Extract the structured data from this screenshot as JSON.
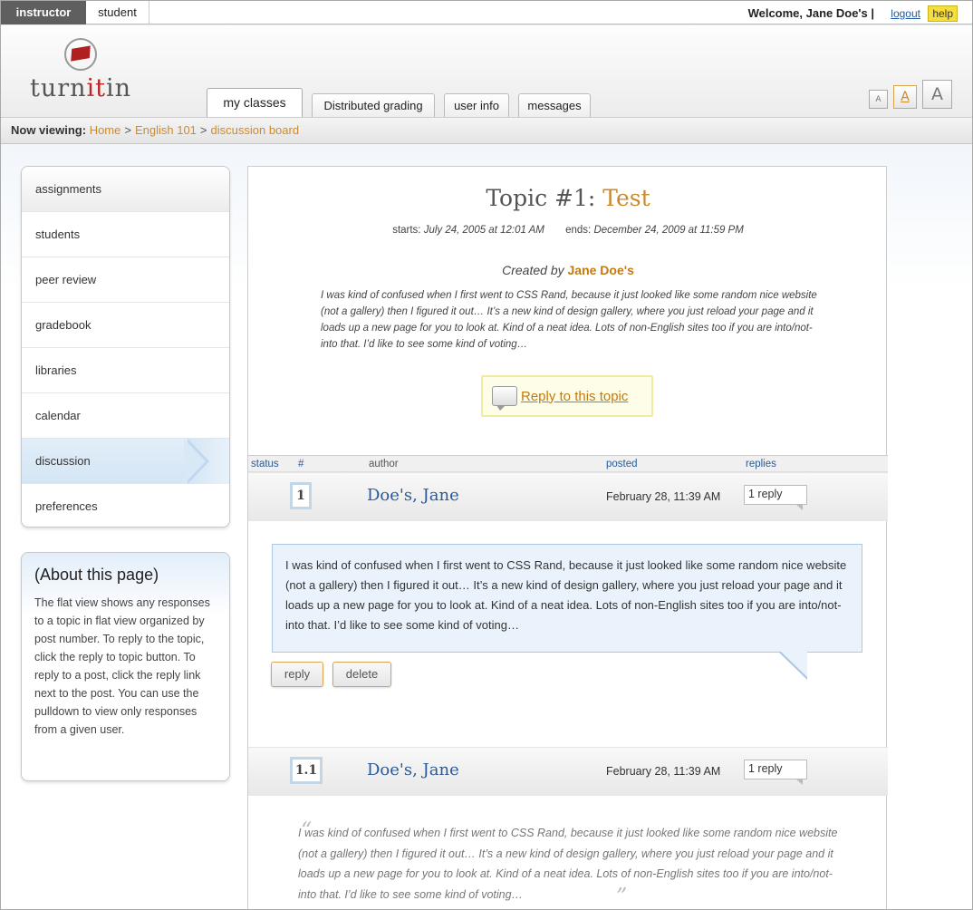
{
  "roles": {
    "instructor": "instructor",
    "student": "student"
  },
  "user": {
    "welcome": "Welcome, Jane Doe's |",
    "logout": "logout",
    "help": "help"
  },
  "logo": {
    "pre": "turn",
    "mid": "it",
    "post": "in"
  },
  "tabs": [
    "my classes",
    "Distributed grading",
    "user info",
    "messages"
  ],
  "font_sizes": [
    "A",
    "A",
    "A"
  ],
  "breadcrumb": {
    "label": "Now viewing:",
    "items": [
      "Home",
      "English 101",
      "discussion board"
    ],
    "separator": ">"
  },
  "sidebar": {
    "items": [
      "assignments",
      "students",
      "peer review",
      "gradebook",
      "libraries",
      "calendar",
      "discussion",
      "preferences"
    ],
    "active": "discussion"
  },
  "about": {
    "title": "(About this page)",
    "text": "The flat view shows any responses to a topic in flat view organized by post number. To reply to the topic, click the reply to topic button. To reply to a post, click the reply link next to the post. You can use the pulldown to view only responses from a given user."
  },
  "topic": {
    "prefix": "Topic #1:",
    "name": "Test",
    "starts_label": "starts:",
    "starts": "July 24, 2005 at 12:01 AM",
    "ends_label": "ends:",
    "ends": "December 24, 2009 at 11:59 PM",
    "created_label": "Created by",
    "created_by": "Jane Doe's",
    "excerpt": "I was kind of confused when I first went to CSS Rand, because it just looked like some random nice website (not a gallery) then I figured it out… It’s a new kind of design gallery, where you just reload your page and it loads up a new page for you to look at. Kind of a neat idea. Lots of non-English sites too if you are into/not-into that. I’d like to see some kind of voting…",
    "reply_button": "Reply to this topic"
  },
  "columns": {
    "status": "status",
    "num": "#",
    "author": "author",
    "posted": "posted",
    "replies": "replies"
  },
  "posts": [
    {
      "num": "1",
      "author": "Doe's, Jane",
      "posted": "February 28, 11:39 AM",
      "replies": "1 reply",
      "body": "I was kind of confused when I first went to CSS Rand, because it just looked like some random nice website (not a gallery) then I figured it out… It’s a new kind of design gallery, where you just reload your page and it loads up a new page for you to look at. Kind of a neat idea. Lots of non-English sites too if you are into/not-into that. I’d like to see some kind of voting…",
      "reply_label": "reply",
      "delete_label": "delete"
    },
    {
      "num": "1.1",
      "author": "Doe's, Jane",
      "posted": "February 28, 11:39 AM",
      "replies": "1 reply",
      "body": "I was kind of confused when I first went to CSS Rand, because it just looked like some random nice website (not a gallery) then I figured it out… It’s a new kind of design gallery, where you just reload your page and it loads up a new page for you to look at. Kind of a neat idea. Lots of non-English sites too if you are into/not-into that. I’d like to see some kind of voting…"
    }
  ],
  "colors": {
    "accent": "#c98a2c",
    "link": "#2a5a96",
    "active_nav": "#d4e5f4"
  }
}
